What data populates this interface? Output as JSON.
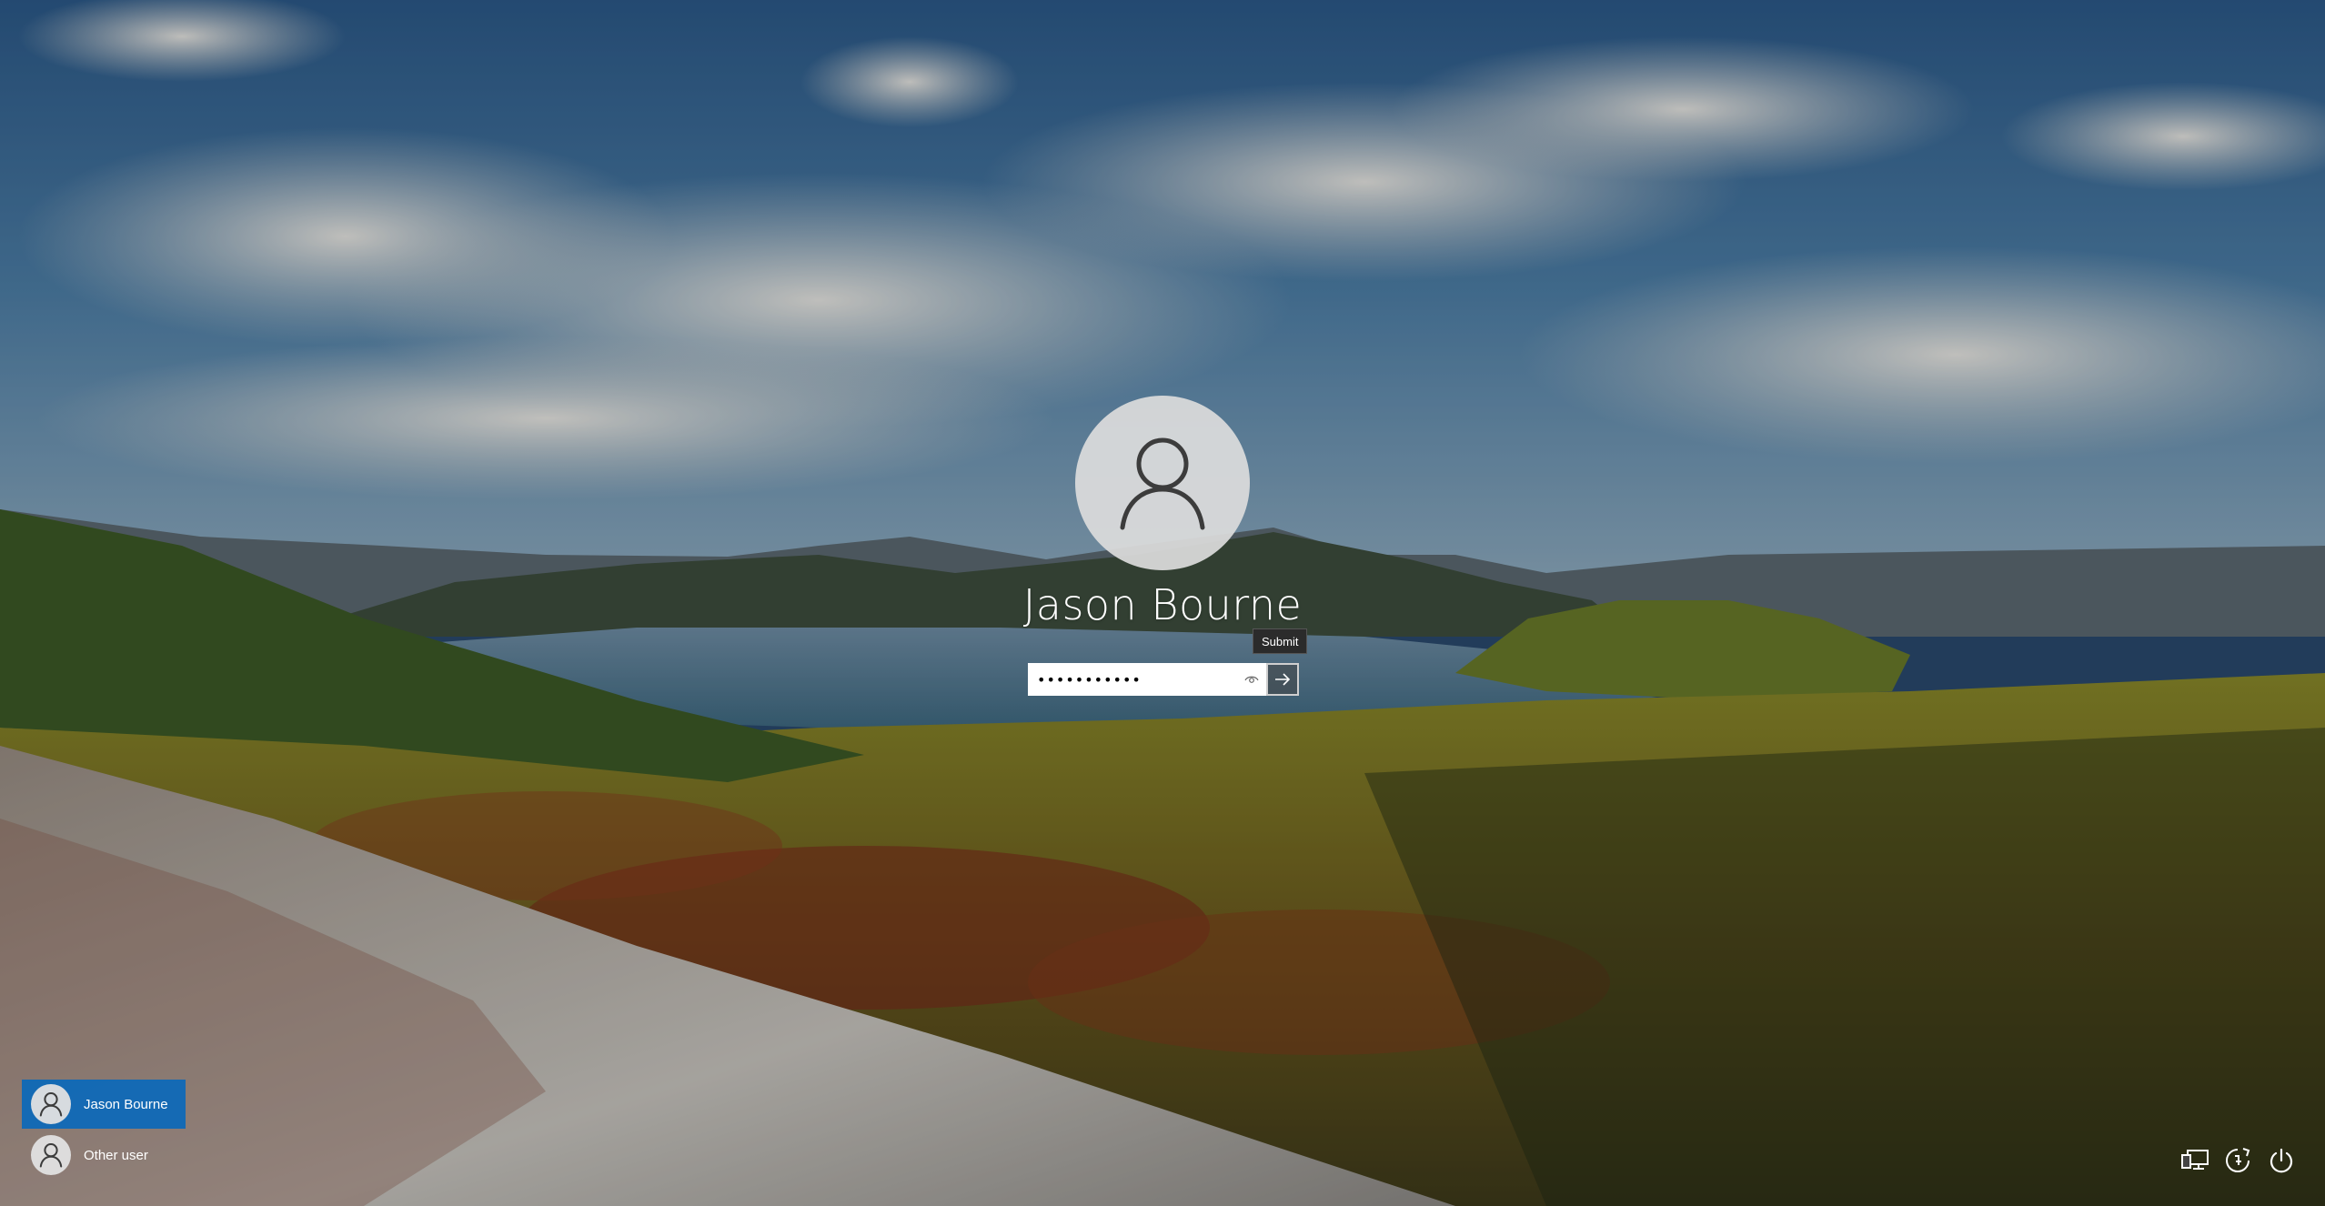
{
  "login": {
    "user_name": "Jason Bourne",
    "password_value": "•••••••••••",
    "submit_tooltip": "Submit"
  },
  "user_switcher": {
    "users": [
      {
        "label": "Jason Bourne",
        "selected": true
      },
      {
        "label": "Other user",
        "selected": false
      }
    ]
  },
  "system_buttons": {
    "icons": [
      "network-icon",
      "ease-of-access-icon",
      "power-icon"
    ]
  },
  "colors": {
    "selected_user_bg": "#0067c0",
    "avatar_bg": "#dcdcdc",
    "icon_gray": "#3c3c3c"
  }
}
